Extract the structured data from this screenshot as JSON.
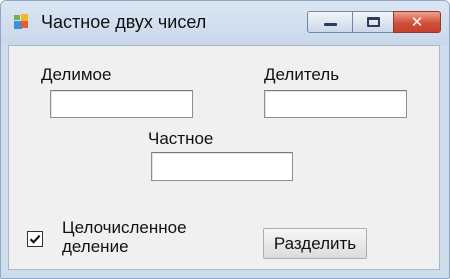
{
  "window": {
    "title": "Частное двух чисел",
    "icon": "windows-forms-app-icon",
    "controls": {
      "minimize": "minimize-icon",
      "maximize": "maximize-icon",
      "close": "✕"
    }
  },
  "form": {
    "dividend": {
      "label": "Делимое",
      "value": ""
    },
    "divisor": {
      "label": "Делитель",
      "value": ""
    },
    "quotient": {
      "label": "Частное",
      "value": ""
    },
    "integer_division": {
      "label_line1": "Целочисленное",
      "label_line2": "деление",
      "checked": true
    },
    "divide_button": "Разделить"
  }
}
